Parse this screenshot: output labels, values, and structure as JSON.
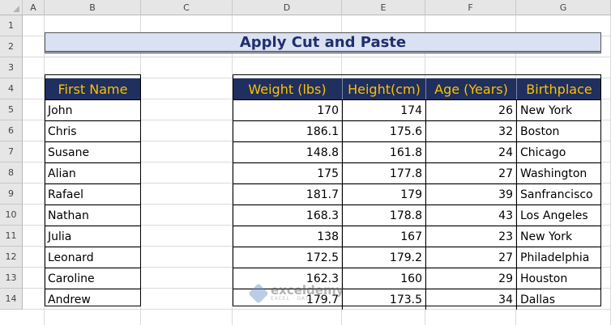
{
  "columns": [
    "A",
    "B",
    "C",
    "D",
    "E",
    "F",
    "G"
  ],
  "rows": [
    "1",
    "2",
    "3",
    "4",
    "5",
    "6",
    "7",
    "8",
    "9",
    "10",
    "11",
    "12",
    "13",
    "14"
  ],
  "title": "Apply Cut and Paste",
  "left_table": {
    "header": "First Name",
    "names": [
      "John",
      "Chris",
      "Susane",
      "Alian",
      "Rafael",
      "Nathan",
      "Julia",
      "Leonard",
      "Caroline",
      "Andrew"
    ]
  },
  "right_table": {
    "headers": [
      "Weight (lbs)",
      "Height(cm)",
      "Age (Years)",
      "Birthplace"
    ],
    "rows": [
      [
        "170",
        "174",
        "26",
        "New York"
      ],
      [
        "186.1",
        "175.6",
        "32",
        "Boston"
      ],
      [
        "148.8",
        "161.8",
        "24",
        "Chicago"
      ],
      [
        "175",
        "177.8",
        "27",
        "Washington"
      ],
      [
        "181.7",
        "179",
        "39",
        "Sanfrancisco"
      ],
      [
        "168.3",
        "178.8",
        "43",
        "Los Angeles"
      ],
      [
        "138",
        "167",
        "23",
        "New York"
      ],
      [
        "172.5",
        "179.2",
        "27",
        "Philadelphia"
      ],
      [
        "162.3",
        "160",
        "29",
        "Houston"
      ],
      [
        "179.7",
        "173.5",
        "34",
        "Dallas"
      ]
    ]
  },
  "watermark": {
    "name": "exceldemy",
    "tagline": "EXCEL · DATA · BI"
  },
  "colors": {
    "header_bg": "#1f2f5e",
    "header_text": "#ffc000",
    "title_bg": "#d9e1f2",
    "title_text": "#1f2f6b"
  }
}
